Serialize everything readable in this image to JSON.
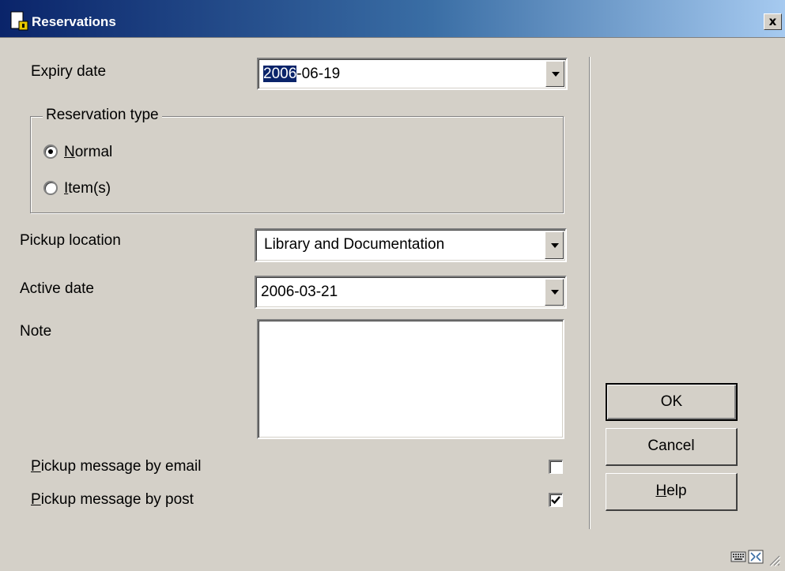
{
  "window": {
    "title": "Reservations",
    "close_glyph": "x"
  },
  "form": {
    "expiry_date": {
      "label": "Expiry date",
      "value_selected": "2006",
      "value_rest": "-06-19"
    },
    "reservation_type": {
      "legend": "Reservation type",
      "options": [
        {
          "label_mnemonic": "N",
          "label_rest": "ormal",
          "checked": true
        },
        {
          "label_mnemonic": "I",
          "label_rest": "tem(s)",
          "checked": false
        }
      ]
    },
    "pickup_location": {
      "label": "Pickup location",
      "value": "Library and Documentation"
    },
    "active_date": {
      "label": "Active date",
      "value": "2006-03-21"
    },
    "note": {
      "label": "Note",
      "value": ""
    },
    "pickup_email": {
      "label_mnemonic": "P",
      "label_rest": "ickup message by email",
      "checked": false
    },
    "pickup_post": {
      "label_mnemonic": "P",
      "label_rest": "ickup message by post",
      "checked": true
    }
  },
  "buttons": {
    "ok": "OK",
    "cancel": "Cancel",
    "help_mnemonic": "H",
    "help_rest": "elp"
  },
  "status_bar": {
    "icons": [
      "keyboard-icon",
      "resize-window-icon",
      "size-grip-icon"
    ]
  },
  "colors": {
    "titlebar_start": "#0a246a",
    "titlebar_end": "#a6caf0",
    "dialog_bg": "#d4d0c8",
    "selection_bg": "#0a246a"
  }
}
